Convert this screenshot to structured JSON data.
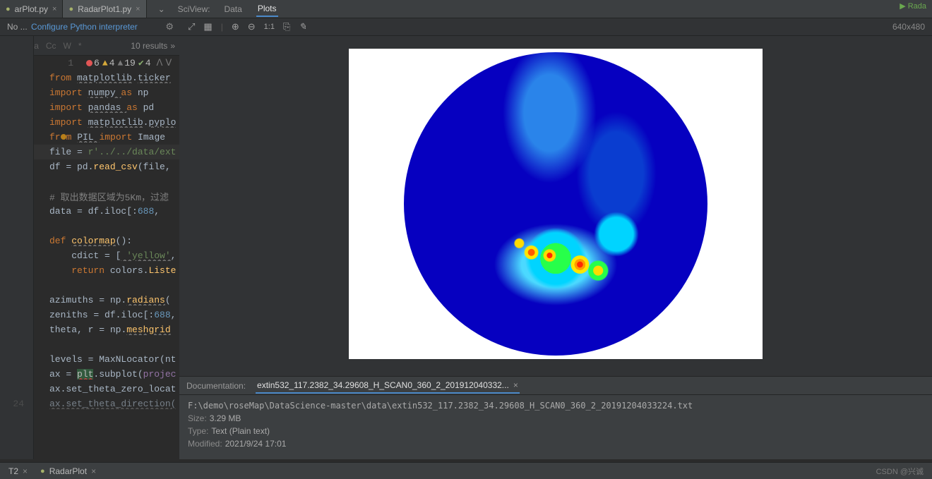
{
  "tabs": {
    "file1": "arPlot.py",
    "file2": "RadarPlot1.py"
  },
  "sciview": {
    "label": "SciView:",
    "data": "Data",
    "plots": "Plots"
  },
  "interp": {
    "no_prefix": "No ...",
    "link": "Configure Python interpreter",
    "one_to_one": "1:1"
  },
  "dim_label": "640x480",
  "search": {
    "aa": "Aa",
    "cc": "Cc",
    "w": "W",
    "star": "*",
    "results": "10 results",
    "arrows": "»"
  },
  "inspections": {
    "red": "6",
    "orange": "4",
    "grey": "19",
    "green": "4"
  },
  "code_lines": {
    "2": {
      "pre": "from ",
      "a": "matplotlib",
      "b": ".",
      "c": "ticker"
    },
    "3": {
      "pre": "import ",
      "a": "numpy ",
      "as": "as ",
      "b": "np"
    },
    "4": {
      "pre": "import ",
      "a": "pandas ",
      "as": "as ",
      "b": "pd"
    },
    "5": {
      "pre": "import ",
      "a": "matplotlib",
      "b": ".",
      "c": "pyplo"
    },
    "6": {
      "pre": "from ",
      "a": "PIL ",
      "im": "import ",
      "b": "Image"
    },
    "7": {
      "a": "file ",
      "eq": "= ",
      "s": "r'../../data/ext"
    },
    "8": {
      "a": "df ",
      "eq": "= pd.",
      "fn": "read_csv",
      "arg": "(file,"
    },
    "10": {
      "text": "# 取出数据区域为5Km，过滤"
    },
    "11": {
      "a": "data ",
      "eq": "= df.iloc[:",
      "n": "688",
      "c": ", "
    },
    "13": {
      "def": "def ",
      "fn": "colormap",
      "p": "():"
    },
    "14": {
      "a": "    cdict ",
      "eq": "= [",
      "s": " 'yellow'",
      "c": ","
    },
    "15": {
      "ret": "    return ",
      "a": "colors.",
      "fn": "Liste"
    },
    "17": {
      "a": "azimuths ",
      "eq": "= np.",
      "fn": "radians",
      "p": "("
    },
    "18": {
      "a": "zeniths ",
      "eq": "= df.iloc[:",
      "n": "688",
      "c": ","
    },
    "19": {
      "a": "theta",
      "b": ", r ",
      "eq": "= np.",
      "fn": "meshgrid"
    },
    "21": {
      "a": "levels ",
      "eq": "= MaxNLocator(",
      "p": "nt"
    },
    "22": {
      "a": "ax ",
      "eq": "= ",
      "plt": "plt",
      "sub": ".subplot(",
      "arg": "projec"
    },
    "23": {
      "a": "ax.set_theta_zero_locat"
    },
    "24": {
      "a": "ax.set_theta_direction("
    }
  },
  "doc": {
    "label": "Documentation:",
    "tab_name": "extin532_117.2382_34.29608_H_SCAN0_360_2_201912040332...",
    "path": "F:\\demo\\roseMap\\DataScience-master\\data\\extin532_117.2382_34.29608_H_SCAN0_360_2_20191204033224.txt",
    "size_label": "Size:",
    "size": "3.29 MB",
    "type_label": "Type:",
    "type": "Text (Plain text)",
    "modified_label": "Modified:",
    "modified": "2021/9/24 17:01"
  },
  "bottom": {
    "t2": "T2",
    "radarplot": "RadarPlot",
    "watermark": "CSDN @兴诚"
  },
  "top_right": "▶ Rada"
}
